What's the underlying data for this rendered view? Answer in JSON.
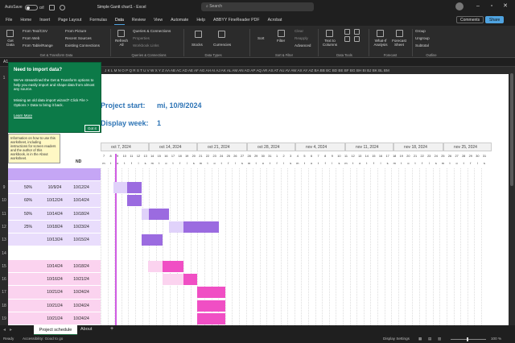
{
  "titlebar": {
    "autosave_label": "AutoSave",
    "autosave_state": "Off",
    "file_name": "Simple Gantt chart1  -  Excel",
    "search_placeholder": "Search",
    "minimize_icon": "minimize-icon",
    "maximize_icon": "restore-icon",
    "close_icon": "close-icon"
  },
  "menu": {
    "items": [
      "File",
      "Home",
      "Insert",
      "Page Layout",
      "Formulas",
      "Data",
      "Review",
      "View",
      "Automate",
      "Help",
      "ABBYY FineReader PDF",
      "Acrobat"
    ],
    "active": "Data",
    "comments": "Comments",
    "share": "Share"
  },
  "ribbon": {
    "get_data": "Get Data",
    "from_text": "From Text/CSV",
    "from_web": "From Web",
    "from_table": "From Table/Range",
    "from_picture": "From Picture",
    "recent_sources": "Recent Sources",
    "existing_connections": "Existing Connections",
    "refresh_all": "Refresh All",
    "queries": "Queries & Connections",
    "properties": "Properties",
    "workbook_links": "Workbook Links",
    "stocks": "Stocks",
    "currencies": "Currencies",
    "sort": "Sort",
    "filter": "Filter",
    "clear": "Clear",
    "reapply": "Reapply",
    "advanced": "Advanced",
    "text_to_columns": "Text to Columns",
    "what_if": "What-If Analysis",
    "forecast_sheet": "Forecast Sheet",
    "group": "Group",
    "ungroup": "Ungroup",
    "subtotal": "Subtotal",
    "groups": [
      "Get & Transform Data",
      "Queries & Connections",
      "Data Types",
      "Sort & Filter",
      "Data Tools",
      "Forecast",
      "Outline"
    ]
  },
  "formula": {
    "cell_ref": "A1"
  },
  "columns": "J  K  L  M  N  O  P  Q  R  S  T  U  V  W  X  Y  Z  AA AB AC AD AE AF AG AH  AI  AJ AK AL AM AN AO AP AQ AR AS AT AU AV AW AX AY AZ BA BB BC BD BE BF BG BH  BI  BJ BK BL BM",
  "popup": {
    "title": "Need to import data?",
    "body1": "We've streamlined the Get & Transform options to help you easily import and shape data from almost any source.",
    "body2": "Missing an old data import wizard? Click File > Options > Data to bring it back.",
    "link": "Learn More",
    "button": "Got it"
  },
  "tooltip": "Information on how to use this worksheet, including instructions for screen readers and the author of this workbook, is in the About worksheet.",
  "project": {
    "start_label": "Project start:",
    "start_value": "mi, 10/9/2024",
    "week_label": "Display week:",
    "week_value": "1"
  },
  "header_fragment": "ND",
  "weeks": [
    "oct 7, 2024",
    "oct 14, 2024",
    "oct 21, 2024",
    "oct 28, 2024",
    "nov 4, 2024",
    "nov 11, 2024",
    "nov 18, 2024",
    "nov 25, 2024"
  ],
  "rows": [
    {
      "num": "9",
      "pct": "50%",
      "start": "10/9/24",
      "end": "10/12/24"
    },
    {
      "num": "10",
      "pct": "60%",
      "start": "10/12/24",
      "end": "10/14/24"
    },
    {
      "num": "11",
      "pct": "50%",
      "start": "10/14/24",
      "end": "10/18/24"
    },
    {
      "num": "12",
      "pct": "25%",
      "start": "10/18/24",
      "end": "10/23/24"
    },
    {
      "num": "13",
      "pct": "",
      "start": "10/13/24",
      "end": "10/15/24"
    },
    {
      "num": "14",
      "pct": "",
      "start": "",
      "end": ""
    },
    {
      "num": "15",
      "pct": "",
      "start": "10/14/24",
      "end": "10/18/24"
    },
    {
      "num": "16",
      "pct": "",
      "start": "10/16/24",
      "end": "10/21/24"
    },
    {
      "num": "17",
      "pct": "",
      "start": "10/21/24",
      "end": "10/24/24"
    },
    {
      "num": "18",
      "pct": "",
      "start": "10/21/24",
      "end": "10/24/24"
    },
    {
      "num": "19",
      "pct": "",
      "start": "10/21/24",
      "end": "10/24/24"
    }
  ],
  "row_numbers_top": [
    "1",
    "2",
    "3",
    "4",
    "5",
    "6",
    "7",
    "8"
  ],
  "tabs": {
    "sheet1": "Project schedule",
    "sheet2": "About",
    "add": "+"
  },
  "status": {
    "ready": "Ready",
    "accessibility": "Accessibility: Good to go",
    "display_settings": "Display Settings",
    "zoom": "100 %"
  },
  "colors": {
    "accent": "#4fa3e0",
    "popup_bg": "#0c7a48",
    "purple_dark": "#9b6be0",
    "purple_light": "#e0d2fa",
    "pink_dark": "#f04fc4",
    "pink_light": "#fbd3ef",
    "title_blue": "#2e74b5"
  }
}
